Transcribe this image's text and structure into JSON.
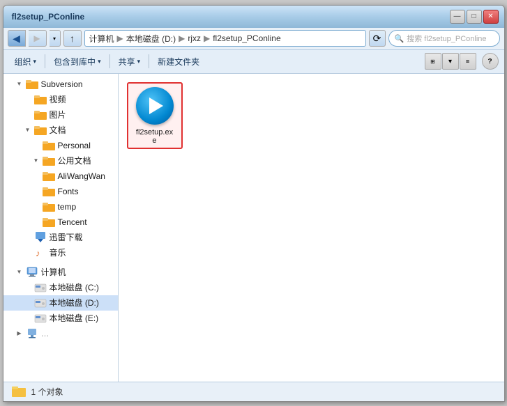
{
  "window": {
    "title": "fl2setup_PConline",
    "title_controls": {
      "minimize": "—",
      "maximize": "□",
      "close": "✕"
    }
  },
  "address": {
    "back_icon": "◀",
    "forward_icon": "▶",
    "up_icon": "↑",
    "path": [
      "计算机",
      "本地磁盘 (D:)",
      "rjxz",
      "fl2setup_PConline"
    ],
    "refresh_icon": "⟳",
    "search_placeholder": "搜索 fl2setup_PConline",
    "search_icon": "🔍"
  },
  "toolbar": {
    "organize": "组织",
    "include_lib": "包含到库中",
    "share": "共享",
    "new_folder": "新建文件夹",
    "dropdown_arrow": "▾",
    "help_icon": "?"
  },
  "sidebar": {
    "items": [
      {
        "label": "Subversion",
        "indent": 1,
        "type": "folder",
        "expanded": true,
        "has_expand": true
      },
      {
        "label": "视频",
        "indent": 2,
        "type": "folder",
        "has_expand": false
      },
      {
        "label": "图片",
        "indent": 2,
        "type": "folder",
        "has_expand": false
      },
      {
        "label": "文档",
        "indent": 2,
        "type": "folder",
        "expanded": true,
        "has_expand": true
      },
      {
        "label": "Personal",
        "indent": 3,
        "type": "folder",
        "has_expand": false
      },
      {
        "label": "公用文档",
        "indent": 3,
        "type": "folder",
        "expanded": true,
        "has_expand": true
      },
      {
        "label": "AliWangWang",
        "indent": 3,
        "type": "folder",
        "has_expand": false
      },
      {
        "label": "Fonts",
        "indent": 3,
        "type": "folder",
        "has_expand": false
      },
      {
        "label": "temp",
        "indent": 3,
        "type": "folder",
        "has_expand": false
      },
      {
        "label": "Tencent",
        "indent": 3,
        "type": "folder",
        "has_expand": false
      },
      {
        "label": "迅雷下载",
        "indent": 2,
        "type": "special",
        "has_expand": false
      },
      {
        "label": "音乐",
        "indent": 2,
        "type": "music",
        "has_expand": false
      },
      {
        "label": "计算机",
        "indent": 1,
        "type": "computer",
        "expanded": true,
        "has_expand": true
      },
      {
        "label": "本地磁盘 (C:)",
        "indent": 2,
        "type": "drive",
        "has_expand": false
      },
      {
        "label": "本地磁盘 (D:)",
        "indent": 2,
        "type": "drive_selected",
        "has_expand": false
      },
      {
        "label": "本地磁盘 (E:)",
        "indent": 2,
        "type": "drive",
        "has_expand": false
      }
    ]
  },
  "content": {
    "files": [
      {
        "name": "fl2setup.exe",
        "type": "exe",
        "selected": true
      }
    ]
  },
  "status": {
    "count_text": "1 个对象",
    "folder_icon": "folder"
  }
}
